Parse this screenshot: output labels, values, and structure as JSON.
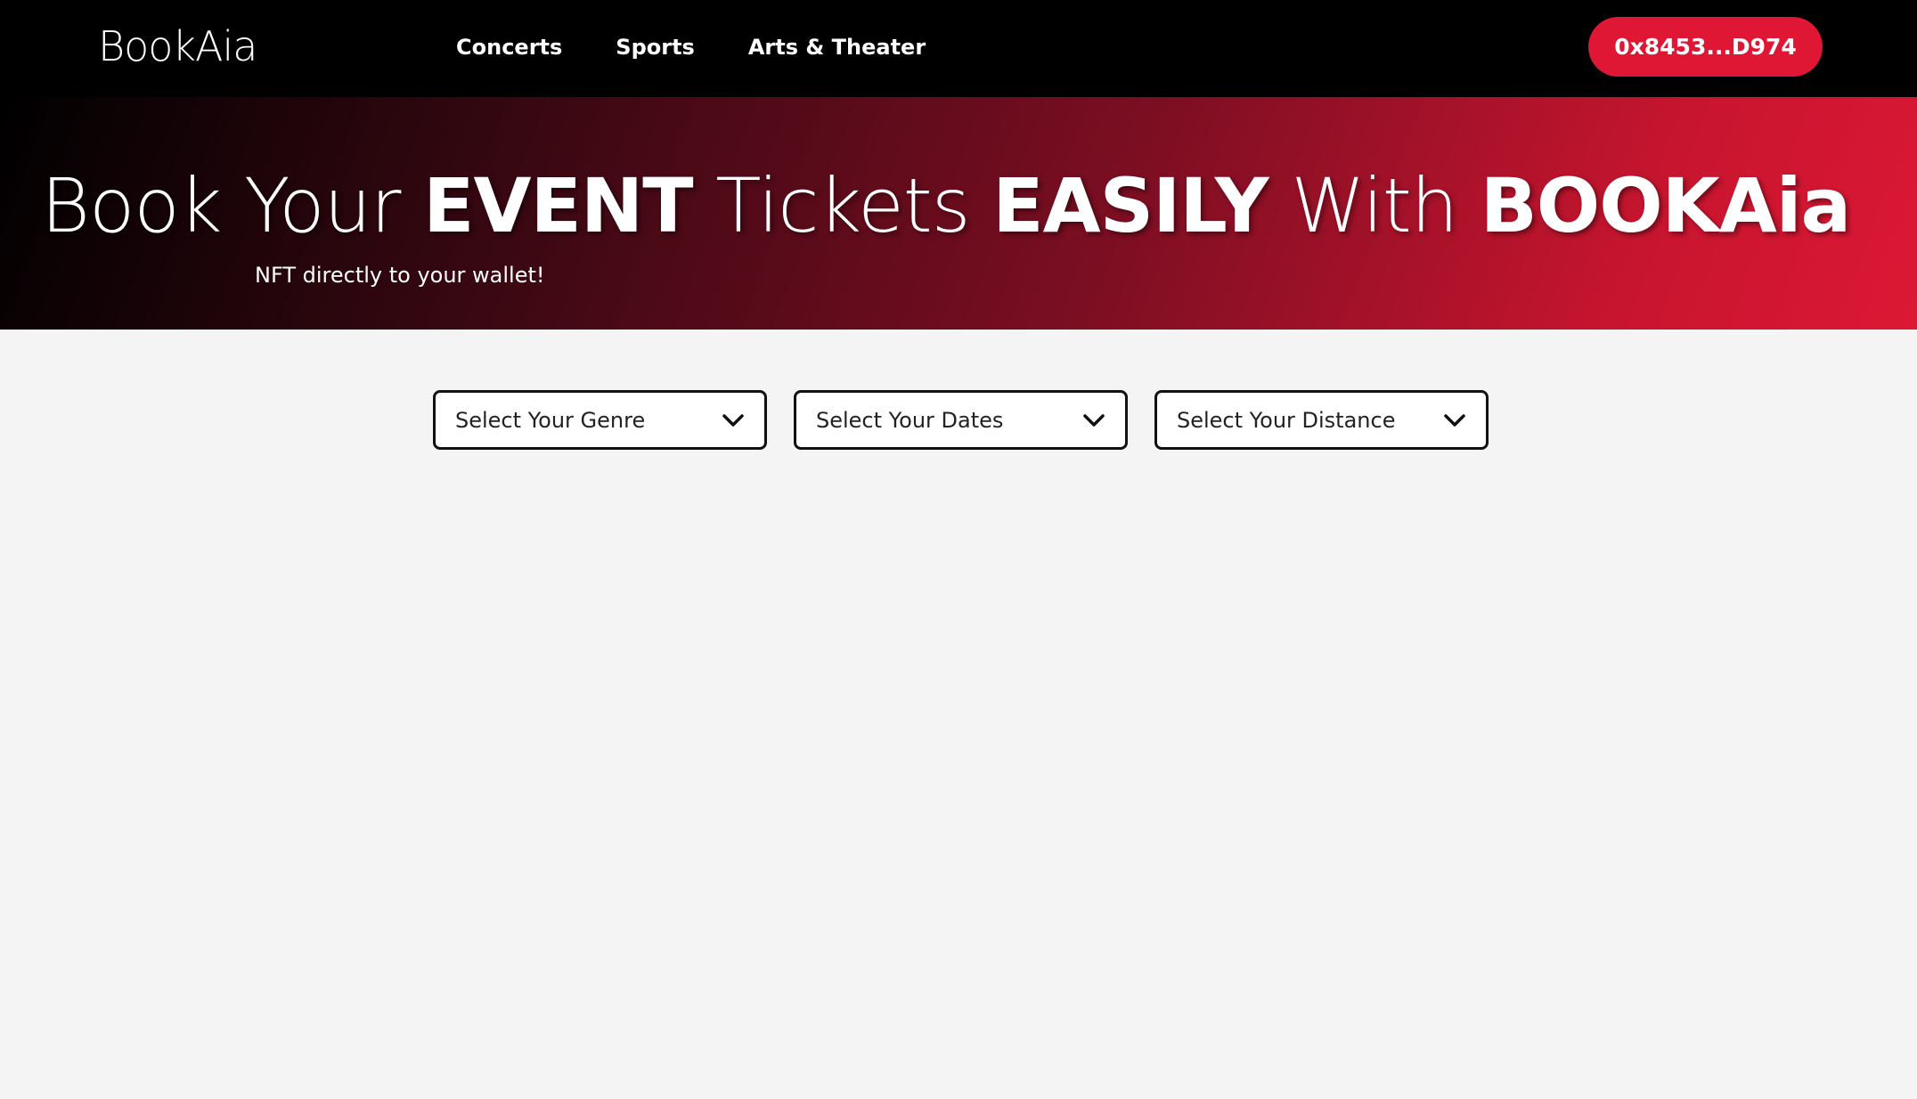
{
  "header": {
    "logo": "BookAia",
    "nav": [
      {
        "label": "Concerts"
      },
      {
        "label": "Sports"
      },
      {
        "label": "Arts & Theater"
      }
    ],
    "wallet_address": "0x8453...D974"
  },
  "hero": {
    "title_parts": {
      "p1": "Book Your ",
      "b1": "EVENT",
      "p2": " Tickets ",
      "b2": "EASILY",
      "p3": " With ",
      "b3": "BOOKAia"
    },
    "subtitle": "NFT directly to your wallet!"
  },
  "filters": [
    {
      "label": "Select Your Genre",
      "icon": "chevron-down-icon"
    },
    {
      "label": "Select Your Dates",
      "icon": "chevron-down-icon"
    },
    {
      "label": "Select Your Distance",
      "icon": "chevron-down-icon"
    }
  ],
  "colors": {
    "navbar_bg": "#000000",
    "accent": "#e01635",
    "page_bg": "#f4f4f4"
  }
}
